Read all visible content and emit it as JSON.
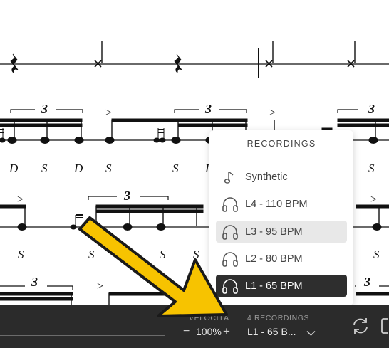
{
  "score": {
    "tuplet_marks": [
      "3",
      "3",
      "3",
      "3",
      "3",
      "3"
    ],
    "accents": [
      ">",
      ">",
      ">",
      ">",
      ">",
      ">",
      ">"
    ],
    "sticking_row_1": [
      "D",
      "S",
      "D",
      "S",
      "S",
      "D",
      "S"
    ],
    "sticking_row_2": [
      "S",
      "S",
      "S",
      "S",
      "S"
    ]
  },
  "recordings_popup": {
    "title": "RECORDINGS",
    "items": [
      {
        "label": "Synthetic",
        "icon": "synthetic-note-icon",
        "state": "normal"
      },
      {
        "label": "L4 - 110 BPM",
        "icon": "headphones-icon",
        "state": "normal"
      },
      {
        "label": "L3 - 95 BPM",
        "icon": "headphones-icon",
        "state": "hover"
      },
      {
        "label": "L2 - 80 BPM",
        "icon": "headphones-icon",
        "state": "normal"
      },
      {
        "label": "L1 - 65 BPM",
        "icon": "headphones-icon",
        "state": "selected"
      }
    ]
  },
  "bottom_bar": {
    "speed_label": "VELOCITÀ",
    "speed_minus": "−",
    "speed_value": "100%",
    "speed_plus": "+",
    "recordings_count_label": "4 RECORDINGS",
    "current_recording": "L1 - 65 B...",
    "icons": [
      "chevron-down-icon",
      "loop-icon",
      "fullscreen-icon"
    ]
  },
  "colors": {
    "bar_background": "#2b2b2b",
    "selected_item": "#2e2e2e",
    "hover_item": "#e8e8e8",
    "arrow_fill": "#f7c300",
    "arrow_outline": "#1a1a1a"
  }
}
